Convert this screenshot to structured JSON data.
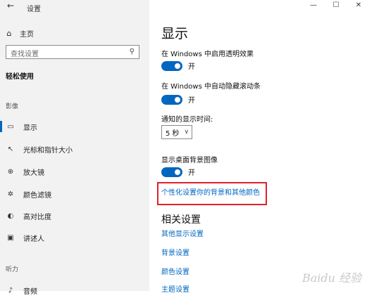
{
  "window": {
    "title": "设置",
    "back_glyph": "←",
    "controls": [
      "—",
      "☐",
      "✕"
    ]
  },
  "sidebar": {
    "home_label": "主页",
    "search_placeholder": "查找设置",
    "section_title": "轻松使用",
    "vision_label": "影像",
    "hearing_label": "听力",
    "items": [
      {
        "label": "显示",
        "icon": "display-icon",
        "active": true
      },
      {
        "label": "光标和指针大小",
        "icon": "cursor-icon"
      },
      {
        "label": "放大镜",
        "icon": "magnifier-icon"
      },
      {
        "label": "颜色滤镜",
        "icon": "color-filter-icon"
      },
      {
        "label": "高对比度",
        "icon": "high-contrast-icon"
      },
      {
        "label": "讲述人",
        "icon": "narrator-icon"
      },
      {
        "label": "音频",
        "icon": "audio-icon"
      }
    ]
  },
  "main": {
    "title": "显示",
    "transparency_label": "在 Windows 中启用透明效果",
    "transparency_state": "开",
    "autohide_scrollbars_label": "在 Windows 中自动隐藏滚动条",
    "autohide_scrollbars_state": "开",
    "notification_time_label": "通知的显示时间:",
    "notification_time_value": "5 秒",
    "desktop_bg_label": "显示桌面背景图像",
    "desktop_bg_state": "开",
    "personalize_link": "个性化设置你的背景和其他颜色",
    "related_title": "相关设置",
    "related_links": [
      "其他显示设置",
      "背景设置",
      "颜色设置",
      "主题设置"
    ]
  },
  "accent_color": "#0067c0",
  "highlight_color": "#e0202a",
  "watermark": "Baidu 经验"
}
